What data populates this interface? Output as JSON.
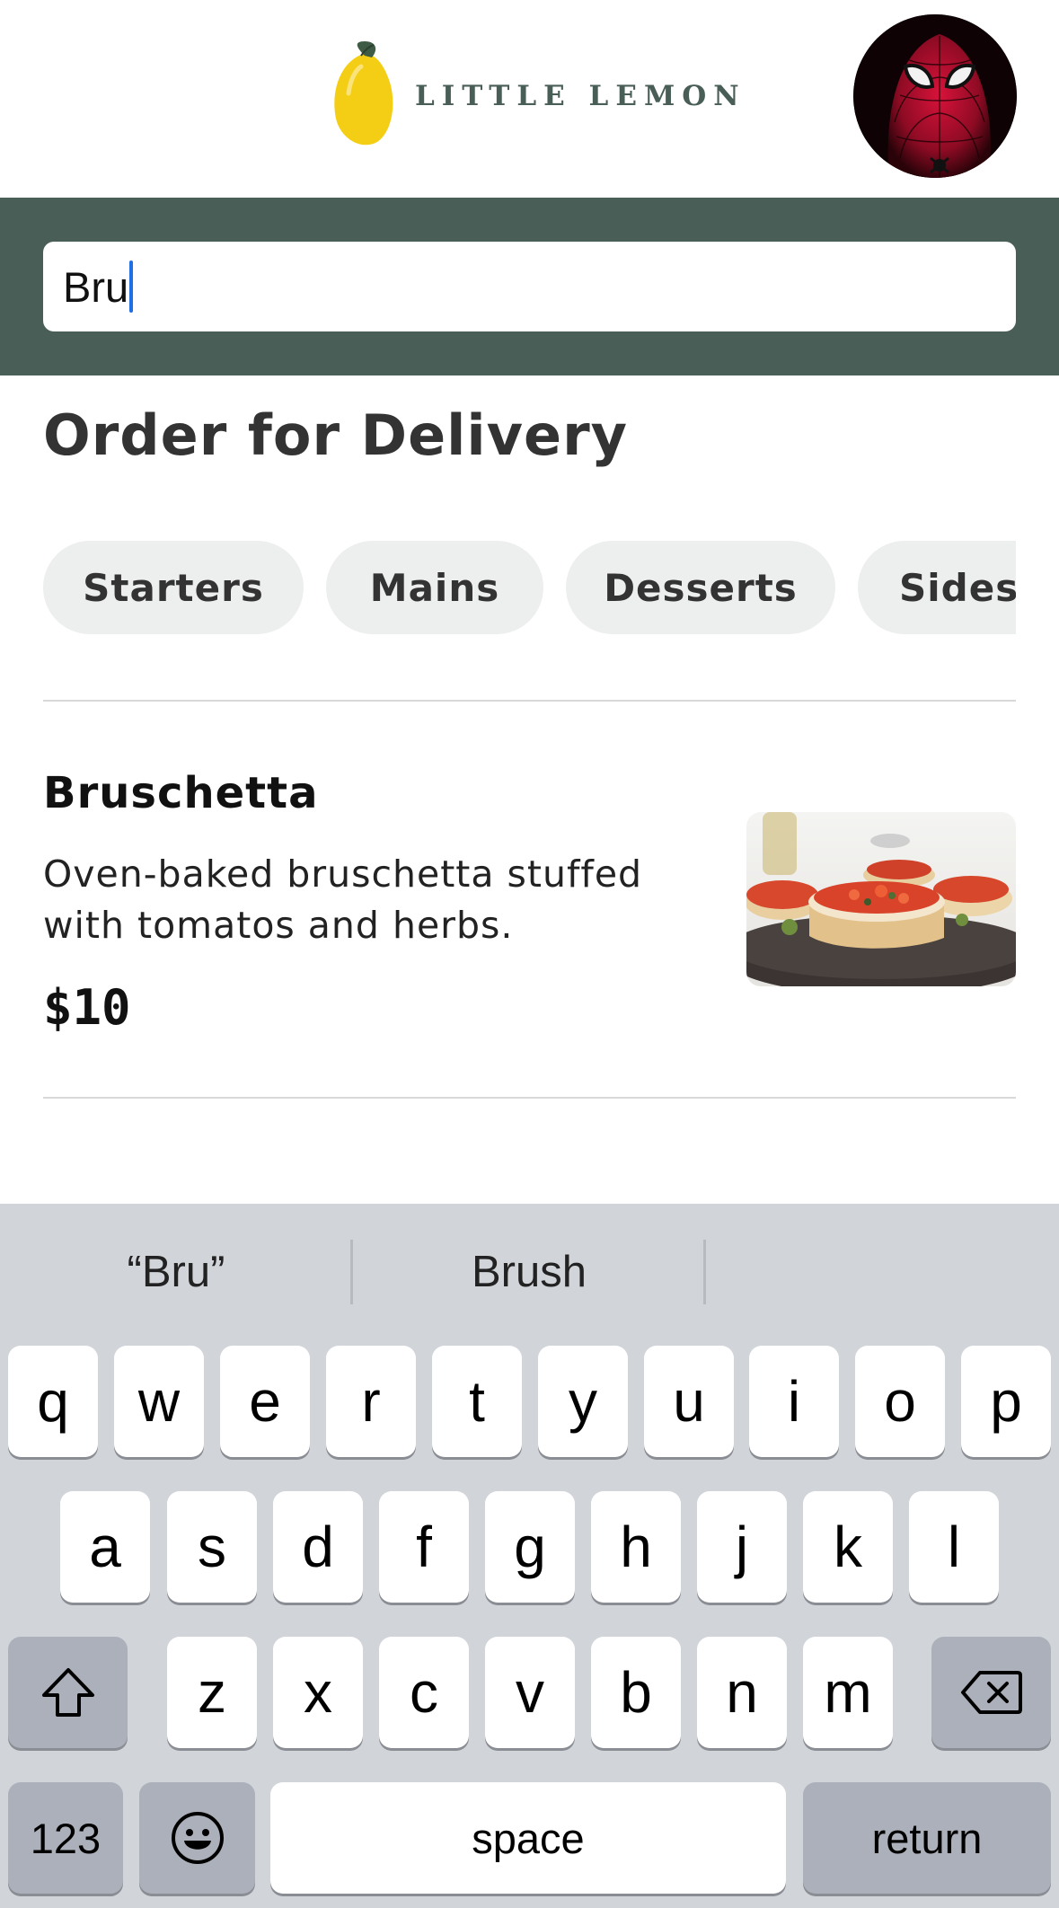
{
  "header": {
    "logo_text": "LITTLE LEMON"
  },
  "search": {
    "value": "Bru"
  },
  "main": {
    "title": "Order for Delivery",
    "categories": [
      "Starters",
      "Mains",
      "Desserts",
      "Sides"
    ]
  },
  "menu": {
    "items": [
      {
        "name": "Bruschetta",
        "description": "Oven-baked bruschetta stuffed with tomatos and herbs.",
        "price": "$10"
      }
    ]
  },
  "keyboard": {
    "suggestions": [
      "“Bru”",
      "Brush"
    ],
    "row1": [
      "q",
      "w",
      "e",
      "r",
      "t",
      "y",
      "u",
      "i",
      "o",
      "p"
    ],
    "row2": [
      "a",
      "s",
      "d",
      "f",
      "g",
      "h",
      "j",
      "k",
      "l"
    ],
    "row3": [
      "z",
      "x",
      "c",
      "v",
      "b",
      "n",
      "m"
    ],
    "numbers_label": "123",
    "space_label": "space",
    "return_label": "return"
  },
  "colors": {
    "brand_green": "#495e57",
    "lemon_yellow": "#f4ce14",
    "chip_bg": "#edefee",
    "keyboard_bg": "#d1d4d9",
    "caret": "#1f6fe5"
  },
  "icons": {
    "logo": "lemon-icon",
    "shift": "shift-icon",
    "delete": "backspace-icon",
    "emoji": "emoji-icon"
  }
}
